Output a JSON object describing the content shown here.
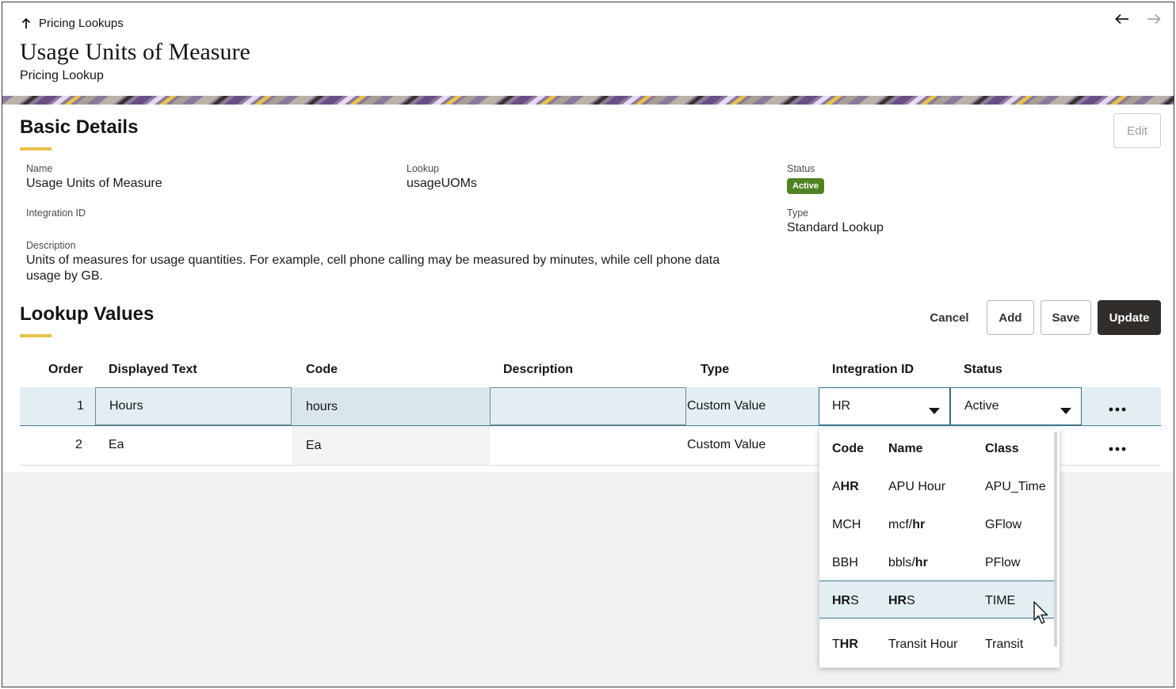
{
  "header": {
    "breadcrumb": "Pricing Lookups",
    "title": "Usage Units of Measure",
    "subtitle": "Pricing Lookup"
  },
  "basic_details": {
    "title": "Basic Details",
    "edit_label": "Edit",
    "name_label": "Name",
    "name_value": "Usage Units of Measure",
    "lookup_label": "Lookup",
    "lookup_value": "usageUOMs",
    "status_label": "Status",
    "status_value": "Active",
    "integration_label": "Integration ID",
    "type_label": "Type",
    "type_value": "Standard Lookup",
    "description_label": "Description",
    "description_line1": "Units of measures for usage quantities. For example, cell phone calling may be measured by minutes, while cell phone data",
    "description_line2": "usage by GB."
  },
  "lookup_values": {
    "title": "Lookup Values",
    "cancel_label": "Cancel",
    "add_label": "Add",
    "save_label": "Save",
    "update_label": "Update",
    "columns": [
      "Order",
      "Displayed Text",
      "Code",
      "Description",
      "Type",
      "Integration ID",
      "Status"
    ],
    "rows": [
      {
        "order": "1",
        "displayed_text": "Hours",
        "code": "hours",
        "description": "",
        "type": "Custom Value",
        "integration_id": "HR",
        "status": "Active"
      },
      {
        "order": "2",
        "displayed_text": "Ea",
        "code": "Ea",
        "description": "",
        "type": "Custom Value",
        "integration_id": "",
        "status": ""
      }
    ]
  },
  "dropdown": {
    "columns": [
      "Code",
      "Name",
      "Class"
    ],
    "options": [
      {
        "code": {
          "pre": "A",
          "bold": "HR",
          "post": ""
        },
        "name": {
          "pre": "APU Hour",
          "bold": "",
          "post": ""
        },
        "class": "APU_Time"
      },
      {
        "code": {
          "pre": "MCH",
          "bold": "",
          "post": ""
        },
        "name": {
          "pre": "mcf/",
          "bold": "hr",
          "post": ""
        },
        "class": "GFlow"
      },
      {
        "code": {
          "pre": "BBH",
          "bold": "",
          "post": ""
        },
        "name": {
          "pre": "bbls/",
          "bold": "hr",
          "post": ""
        },
        "class": "PFlow"
      },
      {
        "code": {
          "pre": "",
          "bold": "HR",
          "post": "S"
        },
        "name": {
          "pre": "",
          "bold": "HR",
          "post": "S"
        },
        "class": "TIME"
      },
      {
        "code": {
          "pre": "T",
          "bold": "HR",
          "post": ""
        },
        "name": {
          "pre": "Transit Hour",
          "bold": "",
          "post": ""
        },
        "class": "Transit"
      }
    ],
    "hovered_index": 3
  },
  "colors": {
    "accent": "#e8c24a",
    "status_active": "#508223",
    "selected_row": "#e3eef3",
    "primary_button": "#312d2a"
  }
}
